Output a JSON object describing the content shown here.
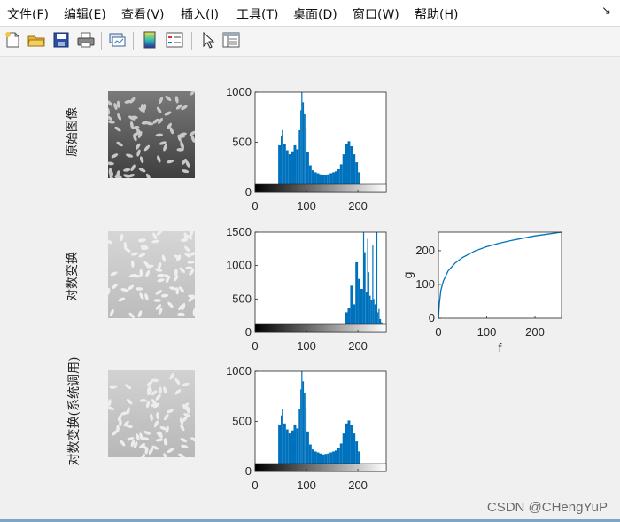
{
  "menu": {
    "items": [
      "文件(F)",
      "编辑(E)",
      "查看(V)",
      "插入(I)",
      "工具(T)",
      "桌面(D)",
      "窗口(W)",
      "帮助(H)"
    ],
    "corner": "↘"
  },
  "toolbar": {
    "icons": [
      "new-figure-icon",
      "open-folder-icon",
      "save-icon",
      "print-icon",
      "link-plot-icon",
      "colorbar-icon",
      "legend-icon",
      "pointer-icon",
      "property-inspector-icon"
    ]
  },
  "rows": [
    {
      "label": "原始图像",
      "image": "rice-original"
    },
    {
      "label": "对数变换",
      "image": "rice-log"
    },
    {
      "label": "对数变换(系统调用)",
      "image": "rice-log-system"
    }
  ],
  "chart_data": [
    {
      "type": "bar",
      "title": "",
      "xlabel": "",
      "ylabel": "",
      "xlim": [
        0,
        255
      ],
      "ylim": [
        0,
        1000
      ],
      "xticks": [
        "0",
        "100",
        "200"
      ],
      "yticks": [
        "0",
        "500",
        "1000"
      ],
      "color": "#0072bd",
      "x": [
        40,
        45,
        50,
        52,
        55,
        60,
        65,
        70,
        75,
        80,
        85,
        88,
        90,
        92,
        95,
        98,
        100,
        105,
        110,
        115,
        120,
        125,
        130,
        135,
        140,
        145,
        150,
        155,
        160,
        165,
        170,
        175,
        180,
        185,
        190,
        195,
        200,
        205,
        210
      ],
      "values": [
        0,
        470,
        560,
        620,
        480,
        420,
        380,
        410,
        470,
        430,
        620,
        820,
        1000,
        900,
        780,
        640,
        400,
        270,
        220,
        200,
        190,
        180,
        170,
        175,
        180,
        190,
        200,
        210,
        230,
        280,
        380,
        480,
        510,
        460,
        380,
        300,
        200,
        30,
        0
      ]
    },
    {
      "type": "bar",
      "title": "",
      "xlabel": "",
      "ylabel": "",
      "xlim": [
        0,
        255
      ],
      "ylim": [
        0,
        1500
      ],
      "xticks": [
        "0",
        "100",
        "200"
      ],
      "yticks": [
        "0",
        "500",
        "1000",
        "1500"
      ],
      "color": "#0072bd",
      "x": [
        170,
        175,
        180,
        185,
        190,
        195,
        200,
        205,
        210,
        212,
        215,
        218,
        220,
        222,
        225,
        228,
        230,
        232,
        235,
        238,
        240,
        242,
        245,
        248,
        250,
        253,
        255
      ],
      "values": [
        0,
        300,
        360,
        700,
        420,
        1050,
        800,
        650,
        1500,
        1200,
        600,
        1400,
        900,
        550,
        480,
        1300,
        500,
        420,
        1500,
        300,
        350,
        200,
        150,
        100,
        60,
        20,
        0
      ]
    },
    {
      "type": "line",
      "title": "",
      "xlabel": "f",
      "ylabel": "g",
      "xlim": [
        0,
        255
      ],
      "ylim": [
        0,
        255
      ],
      "xticks": [
        "0",
        "100",
        "200"
      ],
      "yticks": [
        "0",
        "100",
        "200"
      ],
      "color": "#0072bd",
      "x": [
        0,
        2,
        5,
        10,
        20,
        35,
        50,
        75,
        100,
        125,
        150,
        175,
        200,
        225,
        255
      ],
      "y": [
        0,
        44,
        82,
        110,
        140,
        164,
        180,
        199,
        212,
        222,
        230,
        237,
        244,
        249,
        255
      ]
    },
    {
      "type": "bar",
      "title": "",
      "xlabel": "",
      "ylabel": "",
      "xlim": [
        0,
        255
      ],
      "ylim": [
        0,
        1000
      ],
      "xticks": [
        "0",
        "100",
        "200"
      ],
      "yticks": [
        "0",
        "500",
        "1000"
      ],
      "color": "#0072bd",
      "x": [
        40,
        45,
        50,
        52,
        55,
        60,
        65,
        70,
        75,
        80,
        85,
        88,
        90,
        92,
        95,
        98,
        100,
        105,
        110,
        115,
        120,
        125,
        130,
        135,
        140,
        145,
        150,
        155,
        160,
        165,
        170,
        175,
        180,
        185,
        190,
        195,
        200,
        205,
        210
      ],
      "values": [
        0,
        470,
        560,
        620,
        480,
        420,
        380,
        410,
        470,
        430,
        620,
        820,
        1000,
        900,
        780,
        640,
        400,
        270,
        220,
        200,
        190,
        180,
        170,
        175,
        180,
        190,
        200,
        210,
        230,
        280,
        380,
        480,
        510,
        460,
        380,
        300,
        200,
        30,
        0
      ]
    }
  ],
  "watermark": "CSDN @CHengYuP"
}
